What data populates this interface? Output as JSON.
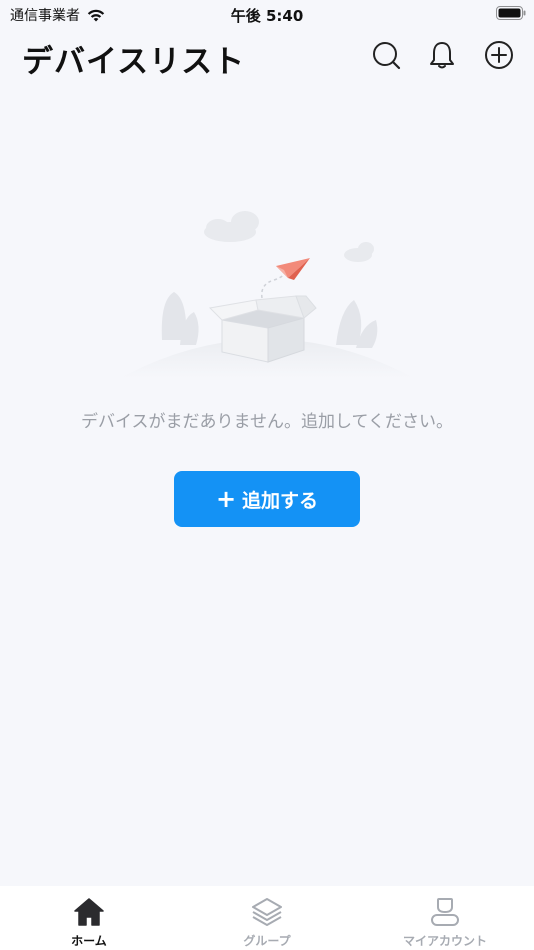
{
  "status_bar": {
    "carrier": "通信事業者",
    "time": "午後 5:40"
  },
  "header": {
    "title": "デバイスリスト",
    "icons": [
      "search-icon",
      "bell-icon",
      "add-circle-icon"
    ]
  },
  "empty_state": {
    "message": "デバイスがまだありません。追加してください。",
    "add_button_icon": "+",
    "add_button_label": "追加する"
  },
  "tabs": [
    {
      "label": "ホーム",
      "icon": "home-icon",
      "active": true
    },
    {
      "label": "グループ",
      "icon": "layers-icon",
      "active": false
    },
    {
      "label": "マイアカウント",
      "icon": "person-icon",
      "active": false
    }
  ],
  "colors": {
    "accent": "#1492f5",
    "background": "#f6f7fb",
    "muted_text": "#9a9ea6"
  }
}
